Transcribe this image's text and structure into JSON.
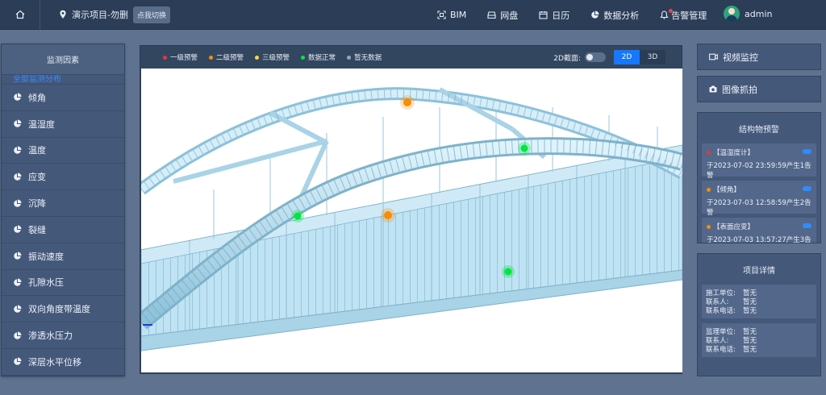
{
  "header": {
    "project_name": "演示项目-勿删",
    "switch_tip": "点我切换",
    "nav": [
      {
        "icon": "bim-icon",
        "label": "BIM"
      },
      {
        "icon": "disk-icon",
        "label": "网盘"
      },
      {
        "icon": "calendar-icon",
        "label": "日历"
      },
      {
        "icon": "pie-chart-icon",
        "label": "数据分析"
      },
      {
        "icon": "bell-icon",
        "label": "告警管理"
      }
    ],
    "user": "admin"
  },
  "left": {
    "title": "监测因素",
    "partial_item": "全部监测分布",
    "factors": [
      "倾角",
      "温湿度",
      "温度",
      "应变",
      "沉降",
      "裂缝",
      "振动速度",
      "孔隙水压",
      "双向角度带温度",
      "渗透水压力",
      "深层水平位移"
    ]
  },
  "viewer": {
    "legend": [
      {
        "label": "一级预警",
        "color": "#e53935"
      },
      {
        "label": "二级预警",
        "color": "#fb8c00"
      },
      {
        "label": "三级预警",
        "color": "#fdd835"
      },
      {
        "label": "数据正常",
        "color": "#00e640"
      },
      {
        "label": "暂无数据",
        "color": "#9aa6b8"
      }
    ],
    "section_label": "2D截面:",
    "mode_2d": "2D",
    "mode_3d": "3D"
  },
  "right": {
    "video_label": "视频监控",
    "capture_label": "图像抓拍",
    "warn_title": "结构物预警",
    "warnings": [
      {
        "name": "【温湿度计】",
        "text": "于2023-07-02 23:59:59产生1告警",
        "color": "#e53935"
      },
      {
        "name": "【倾角】",
        "text": "于2023-07-03 12:58:59产生2告警",
        "color": "#fb8c00"
      },
      {
        "name": "【表面应变】",
        "text": "于2023-07-03 13:57:27产生3告警",
        "color": "#fb8c00"
      }
    ],
    "detail_title": "项目详情",
    "details": [
      {
        "rows": [
          [
            "施工单位:",
            "暂无"
          ],
          [
            "联系人:",
            "暂无"
          ],
          [
            "联系电话:",
            "暂无"
          ]
        ]
      },
      {
        "rows": [
          [
            "监理单位:",
            "暂无"
          ],
          [
            "联系人:",
            "暂无"
          ],
          [
            "联系电话:",
            "暂无"
          ]
        ]
      }
    ]
  }
}
